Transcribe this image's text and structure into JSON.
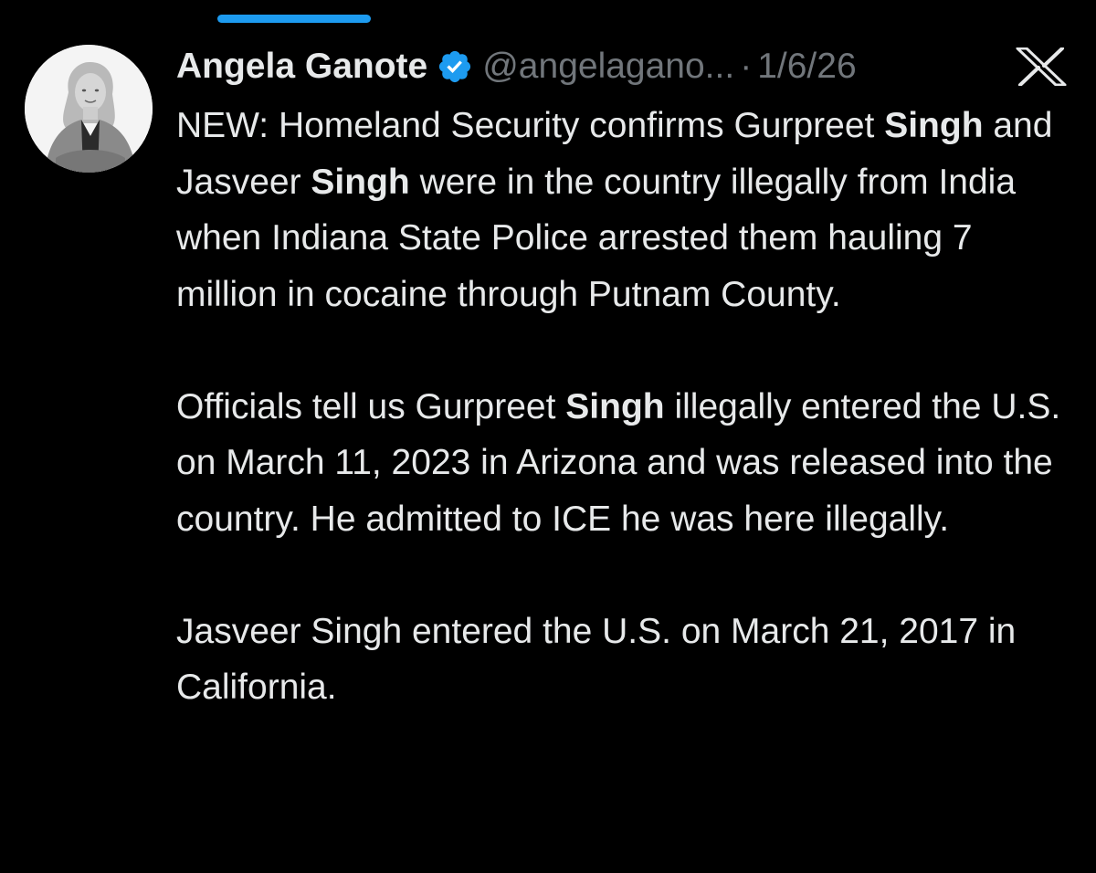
{
  "colors": {
    "background": "#000000",
    "text": "#e7e9ea",
    "muted": "#71767b",
    "accent": "#1d9bf0"
  },
  "header": {
    "author_name": "Angela Ganote",
    "verified_icon": "verified-badge-icon",
    "handle": "@angelagano...",
    "separator": "·",
    "date": "1/6/26",
    "platform_logo": "x-logo-icon"
  },
  "avatar": {
    "icon": "profile-photo"
  },
  "tweet": {
    "p1": {
      "s1": "NEW:  Homeland Security confirms Gurpreet ",
      "b1": "Singh",
      "s2": " and Jasveer ",
      "b2": "Singh",
      "s3": " were in the country illegally from India when Indiana State Police arrested them hauling 7 million in cocaine through Putnam County."
    },
    "p2": {
      "s1": "Officials tell us Gurpreet ",
      "b1": "Singh",
      "s2": " illegally entered the U.S. on March 11, 2023 in Arizona and was released into the country. He admitted to ICE he was here illegally."
    },
    "p3": {
      "s1": "Jasveer Singh entered the U.S. on March 21, 2017 in California."
    }
  }
}
